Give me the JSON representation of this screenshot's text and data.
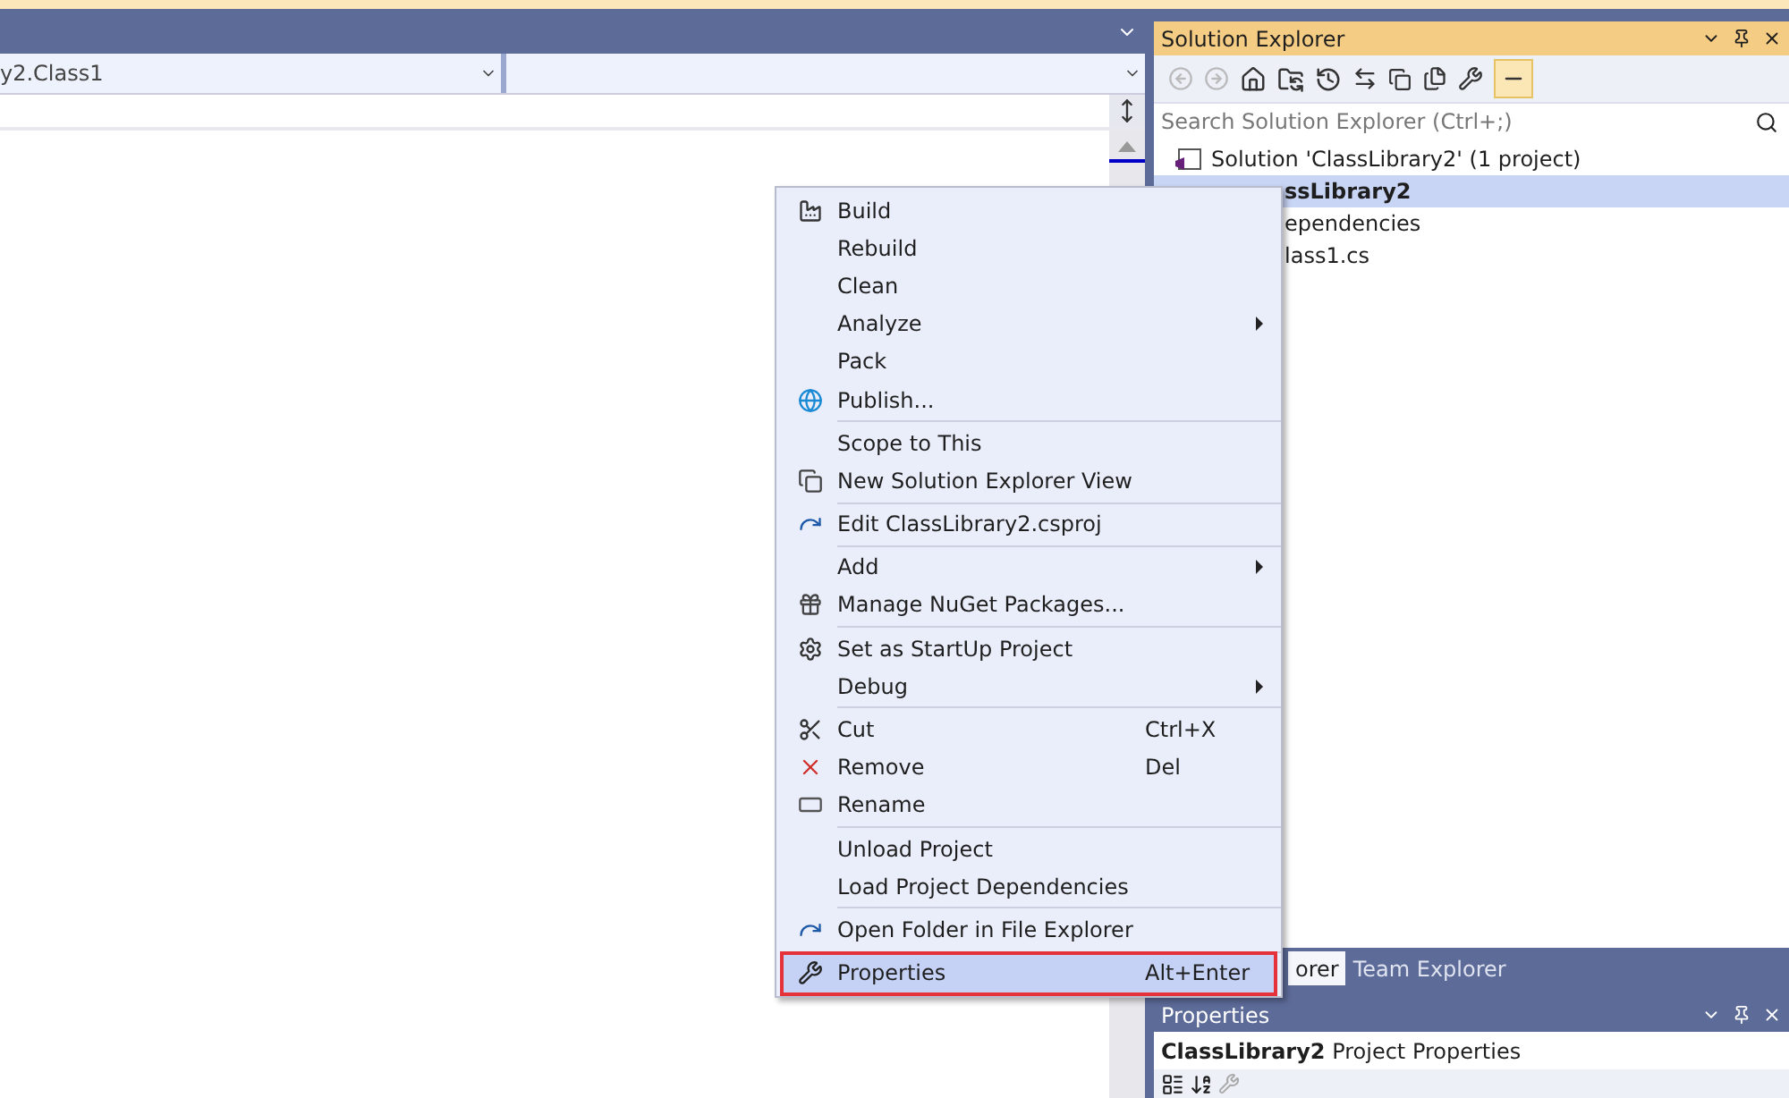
{
  "editor": {
    "class_dropdown": "y2.Class1"
  },
  "solution_explorer": {
    "title": "Solution Explorer",
    "search": {
      "placeholder": "Search Solution Explorer (Ctrl+;)"
    },
    "tree": [
      {
        "label": "Solution 'ClassLibrary2' (1 project)",
        "selected": false,
        "children": [
          {
            "label": "ssLibrary2",
            "selected": true,
            "children": [
              {
                "label": "ependencies",
                "selected": false
              },
              {
                "label": "lass1.cs",
                "selected": false
              }
            ]
          }
        ]
      }
    ],
    "tabs": [
      {
        "label": "orer",
        "selected": true
      },
      {
        "label": "Team Explorer",
        "selected": false
      }
    ]
  },
  "properties": {
    "title": "Properties",
    "object": "**ClassLibrary2** Project Properties"
  },
  "context_menu": {
    "groups": [
      [
        {
          "label": "Build",
          "submenu": false,
          "selected": false
        },
        {
          "label": "Rebuild",
          "submenu": false,
          "selected": false
        },
        {
          "label": "Clean",
          "submenu": false,
          "selected": false
        },
        {
          "label": "Analyze",
          "submenu": true,
          "selected": false
        },
        {
          "label": "Pack",
          "submenu": false,
          "selected": false
        },
        {
          "label": "Publish...",
          "submenu": false,
          "selected": false
        }
      ],
      [
        {
          "label": "Scope to This",
          "submenu": false,
          "selected": false
        },
        {
          "label": "New Solution Explorer View",
          "submenu": false,
          "selected": false
        }
      ],
      [
        {
          "label": "Edit ClassLibrary2.csproj",
          "submenu": false,
          "selected": false
        }
      ],
      [
        {
          "label": "Add",
          "submenu": true,
          "selected": false
        },
        {
          "label": "Manage NuGet Packages...",
          "submenu": false,
          "selected": false
        }
      ],
      [
        {
          "label": "Set as StartUp Project",
          "submenu": false,
          "selected": false
        },
        {
          "label": "Debug",
          "submenu": true,
          "selected": false
        }
      ],
      [
        {
          "label": "Cut",
          "shortcut": "Ctrl+X",
          "submenu": false,
          "selected": false
        },
        {
          "label": "Remove",
          "shortcut": "Del",
          "submenu": false,
          "selected": false
        },
        {
          "label": "Rename",
          "submenu": false,
          "selected": false
        }
      ],
      [
        {
          "label": "Unload Project",
          "submenu": false,
          "selected": false
        },
        {
          "label": "Load Project Dependencies",
          "submenu": false,
          "selected": false
        }
      ],
      [
        {
          "label": "Open Folder in File Explorer",
          "submenu": false,
          "selected": false
        }
      ],
      [
        {
          "label": "Properties",
          "shortcut": "Alt+Enter",
          "submenu": false,
          "selected": true
        }
      ]
    ]
  }
}
